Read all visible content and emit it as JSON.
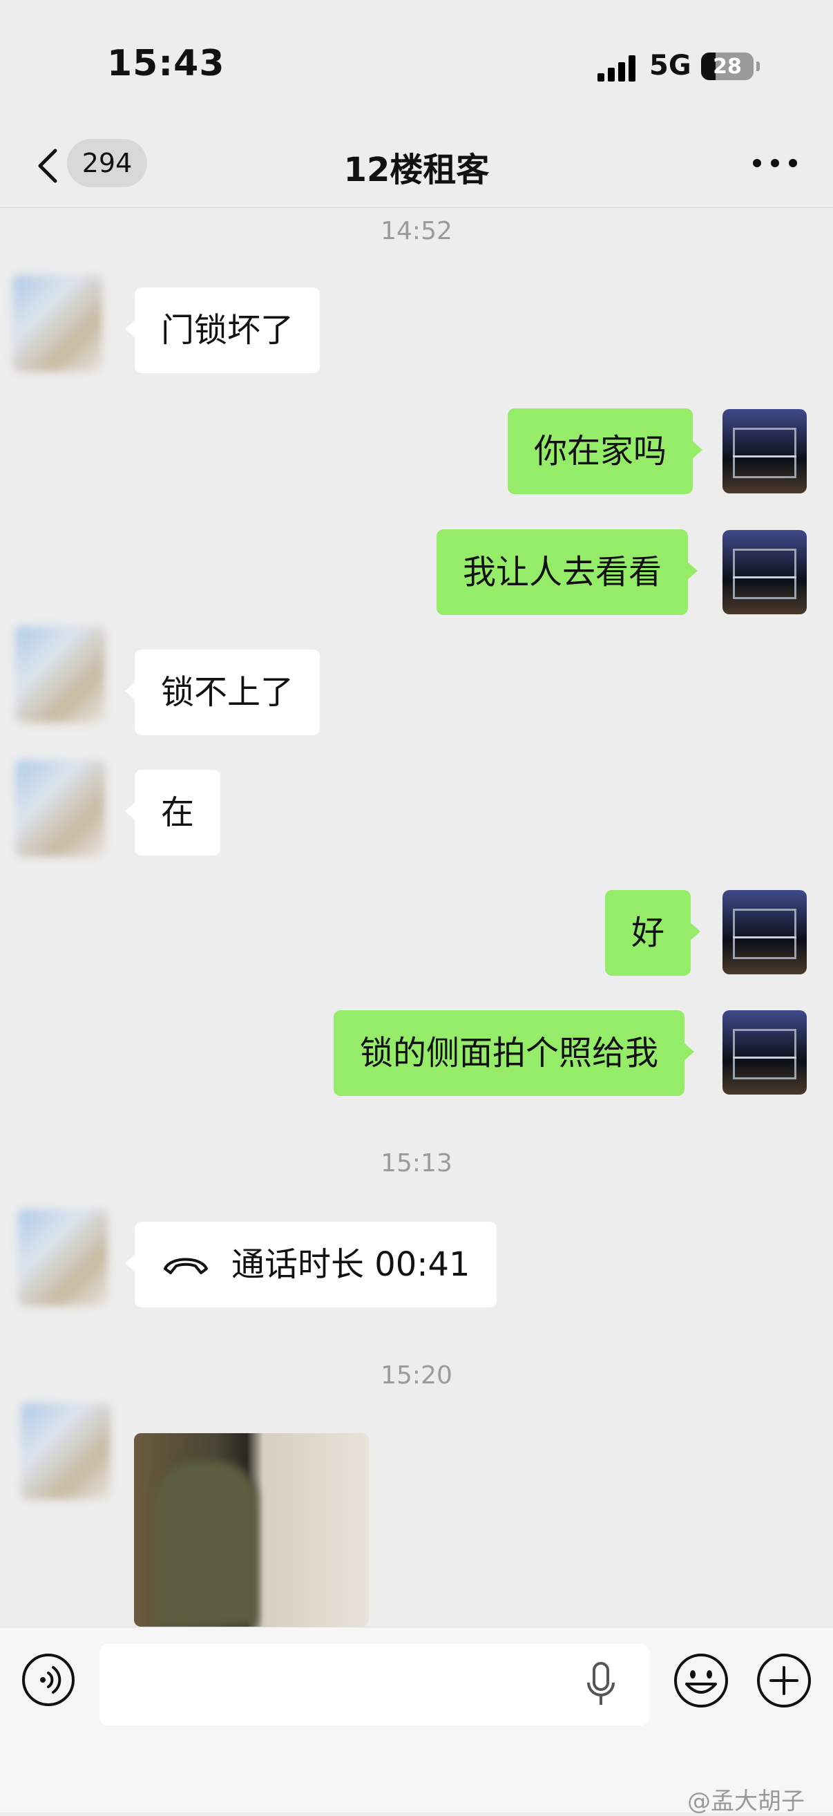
{
  "status": {
    "time": "15:43",
    "network": "5G",
    "battery": "28",
    "battery_level": 0.28
  },
  "header": {
    "unread_count": "294",
    "title": "12楼租客"
  },
  "messages": [
    {
      "type": "timestamp",
      "text": "14:52"
    },
    {
      "type": "text",
      "from": "other",
      "text": "门锁坏了"
    },
    {
      "type": "text",
      "from": "me",
      "text": "你在家吗"
    },
    {
      "type": "text",
      "from": "me",
      "text": "我让人去看看"
    },
    {
      "type": "text",
      "from": "other",
      "text": "锁不上了"
    },
    {
      "type": "text",
      "from": "other",
      "text": "在"
    },
    {
      "type": "text",
      "from": "me",
      "text": "好"
    },
    {
      "type": "text",
      "from": "me",
      "text": "锁的侧面拍个照给我"
    },
    {
      "type": "timestamp",
      "text": "15:13"
    },
    {
      "type": "call",
      "from": "other",
      "text": "通话时长 00:41"
    },
    {
      "type": "timestamp",
      "text": "15:20"
    },
    {
      "type": "image",
      "from": "other"
    }
  ],
  "input": {
    "value": "",
    "placeholder": ""
  },
  "watermark": "@孟大胡子",
  "colors": {
    "background": "#ededed",
    "bubble_out": "#95ec69",
    "bubble_in": "#ffffff",
    "timestamp": "#9b9b9b"
  }
}
